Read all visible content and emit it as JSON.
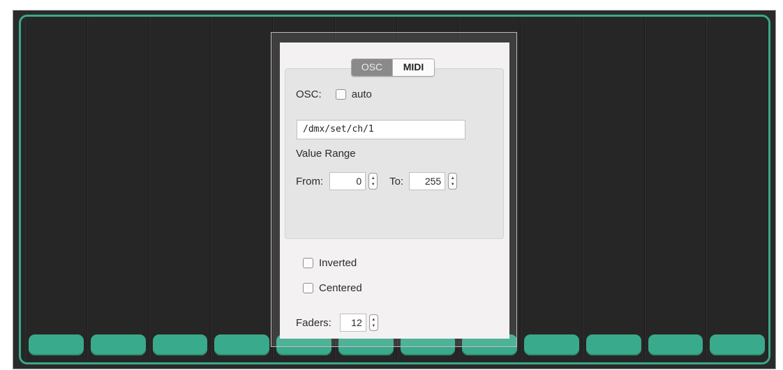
{
  "tabs": {
    "osc": "OSC",
    "midi": "MIDI",
    "selected": "OSC"
  },
  "osc": {
    "label": "OSC:",
    "auto_label": "auto",
    "auto_checked": false,
    "address": "/dmx/set/ch/1",
    "value_range_label": "Value Range",
    "from_label": "From:",
    "from_value": "0",
    "to_label": "To:",
    "to_value": "255"
  },
  "options": {
    "inverted_label": "Inverted",
    "inverted_checked": false,
    "centered_label": "Centered",
    "centered_checked": false
  },
  "faders": {
    "label": "Faders:",
    "value": "12",
    "count": 12
  },
  "colors": {
    "accent": "#3aa98c",
    "panel_bg": "#262626",
    "dialog_bg": "#f3f1f2"
  },
  "icons": {
    "stepper": "stepper-arrows-icon",
    "checkbox": "checkbox-icon"
  }
}
